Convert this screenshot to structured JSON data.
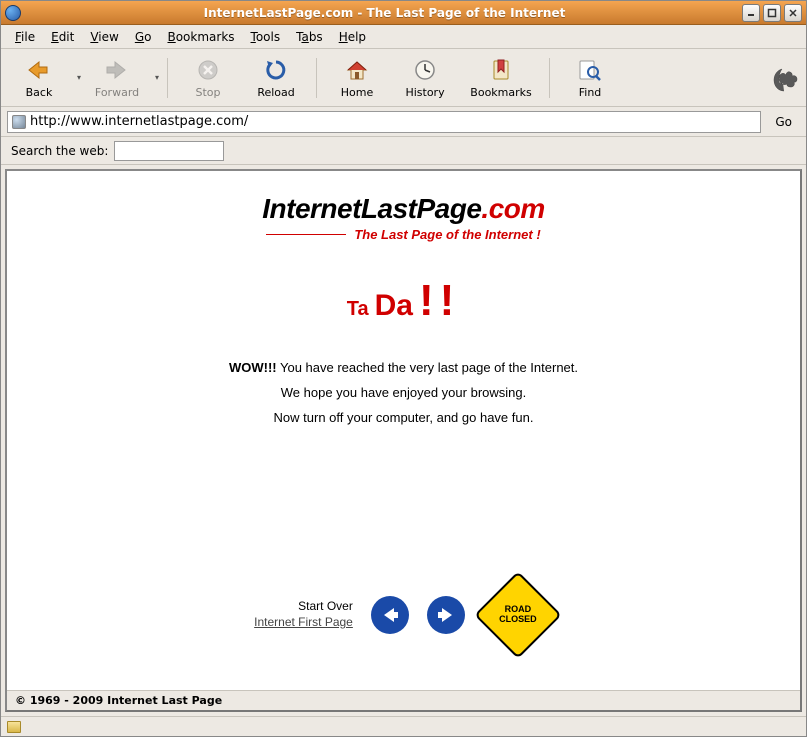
{
  "window": {
    "title": "InternetLastPage.com - The Last Page of the Internet"
  },
  "menubar": {
    "items": [
      {
        "label": "File",
        "ul": "F"
      },
      {
        "label": "Edit",
        "ul": "E"
      },
      {
        "label": "View",
        "ul": "V"
      },
      {
        "label": "Go",
        "ul": "G"
      },
      {
        "label": "Bookmarks",
        "ul": "B"
      },
      {
        "label": "Tools",
        "ul": "T"
      },
      {
        "label": "Tabs",
        "ul": "a"
      },
      {
        "label": "Help",
        "ul": "H"
      }
    ]
  },
  "toolbar": {
    "back": "Back",
    "forward": "Forward",
    "stop": "Stop",
    "reload": "Reload",
    "home": "Home",
    "history": "History",
    "bookmarks": "Bookmarks",
    "find": "Find"
  },
  "address": {
    "url": "http://www.internetlastpage.com/",
    "go": "Go"
  },
  "search": {
    "label": "Search the web:",
    "value": ""
  },
  "page": {
    "logo_main": "InternetLastPage",
    "logo_dot": ".",
    "logo_com": "com",
    "tagline": "The Last Page of the Internet !",
    "tada_1": "Ta",
    "tada_2": "Da",
    "tada_3": "!!",
    "wow": "WOW!!!",
    "wow_rest": " You have reached the very last page of the Internet.",
    "line2": "We hope you have enjoyed your browsing.",
    "line3": "Now turn off your computer, and go have fun.",
    "start_over": "Start Over",
    "first_page_link": "Internet First Page",
    "road_closed_l1": "ROAD",
    "road_closed_l2": "CLOSED",
    "copyright": "© 1969 - 2009 Internet Last Page"
  }
}
